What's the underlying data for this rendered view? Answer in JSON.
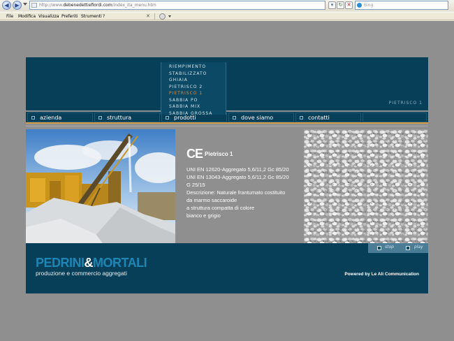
{
  "browser": {
    "address_prefix": "http://www.",
    "address_domain": "debenedettiefiordi.com",
    "address_suffix": "/index_ita_menu.htm",
    "search_placeholder": "Bing",
    "menu": [
      "File",
      "Modifica",
      "Visualizza",
      "Preferiti",
      "Strumenti",
      "?"
    ]
  },
  "site": {
    "page_label": "PIETRISCO 1",
    "dropdown": [
      "RIEMPIMENTO",
      "STABILIZZATO",
      "GHIAIA",
      "PIETRISCO 2",
      "PIETRISCO 1",
      "SABBIA PO",
      "SABBIA MIX",
      "SABBIA GROSSA"
    ],
    "dropdown_active_index": 4,
    "nav": [
      "azienda",
      "struttura",
      "prodotti",
      "dove siamo",
      "contatti"
    ],
    "product": {
      "ce_mark": "CE",
      "title": "Pietrisco 1",
      "lines": [
        "UNI EN 12620-Aggregato 5,6/11,2 Gc 85/20",
        "UNI EN 13043-Aggregato 5,6/11,2 Gc 85/20",
        "G 25/15",
        "Descrizione: Naturale frantumato costituito",
        "da marmo saccaroide",
        "a struttura compatta di colore",
        "bianco e grigio"
      ]
    },
    "controls": {
      "stop": "stop",
      "play": "play"
    },
    "logo": {
      "part1": "PEDRINI",
      "amp": "&",
      "part2": "MORTALI",
      "tagline": "produzione e commercio aggregati"
    },
    "powered_by": "Powered by Le Ali Communication"
  },
  "colors": {
    "brand_navy": "#073e58",
    "accent_orange": "#e98b37",
    "logo_blue": "#1d86b4",
    "page_gray": "#8f8f8f"
  }
}
